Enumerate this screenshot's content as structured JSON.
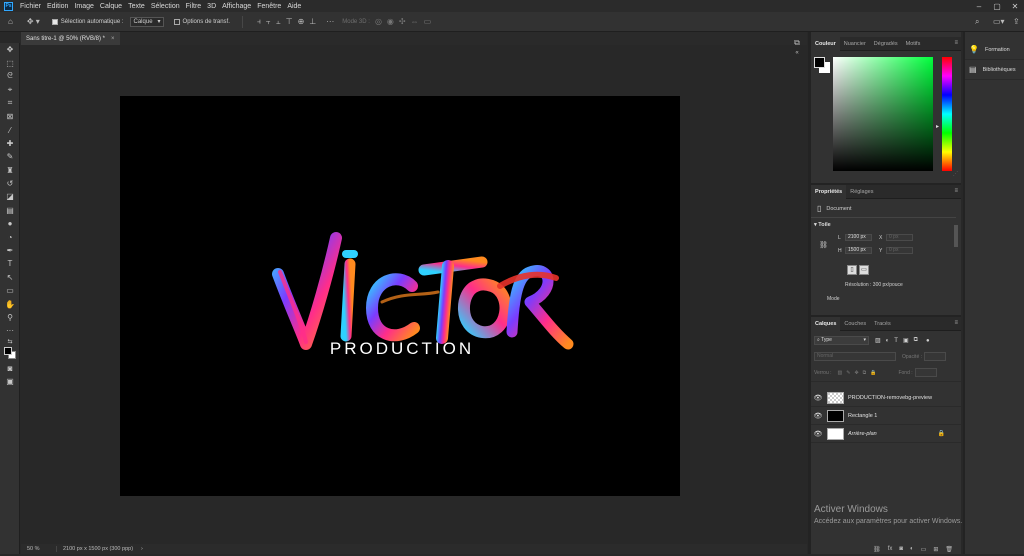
{
  "menubar": {
    "app_icon": "Ps",
    "items": [
      "Fichier",
      "Edition",
      "Image",
      "Calque",
      "Texte",
      "Sélection",
      "Filtre",
      "3D",
      "Affichage",
      "Fenêtre",
      "Aide"
    ]
  },
  "options_bar": {
    "auto_select_label": "Sélection automatique :",
    "auto_select_value": "Calque",
    "transform_label": "Options de transf.",
    "mode_3d_label": "Mode 3D :"
  },
  "document": {
    "tab_label": "Sans titre-1 @ 50% (RVB/8) *",
    "close_glyph": "×"
  },
  "artwork": {
    "title_text": "Victor",
    "subtitle_text": "PRODUCTION",
    "colors": {
      "cyan": "#2fd1ff",
      "magenta": "#ff2d8a",
      "orange": "#ff8a1f",
      "purple": "#7b3cff",
      "red": "#e8322a"
    }
  },
  "status": {
    "zoom": "50 %",
    "doc_size": "2100 px x 1500 px (300 ppp)",
    "arrow": "›"
  },
  "color_panel": {
    "tabs": [
      "Couleur",
      "Nuancier",
      "Dégradés",
      "Motifs"
    ],
    "active_tab": "Couleur",
    "hue": "#00ff3c"
  },
  "properties_panel": {
    "tabs": [
      "Propriétés",
      "Réglages"
    ],
    "active_tab": "Propriétés",
    "doc_label": "Document",
    "section_label": "Toile",
    "w_label": "L",
    "w_value": "2100 px",
    "h_label": "H",
    "h_value": "1500 px",
    "x_label": "X",
    "y_label": "Y",
    "x_placeholder": "0 px",
    "y_placeholder": "0 px",
    "resolution": "Résolution : 300 px/pouce",
    "mode_label": "Mode"
  },
  "layers_panel": {
    "tabs": [
      "Calques",
      "Couches",
      "Tracés"
    ],
    "active_tab": "Calques",
    "filter_label": "Type",
    "blend_mode": "Normal",
    "opacity_label": "Opacité :",
    "lock_label": "Verrou :",
    "fill_label": "Fond :",
    "layers": [
      {
        "name": "PRODUCTION-removebg-preview",
        "visible": true,
        "italic": false
      },
      {
        "name": "Rectangle 1",
        "visible": true,
        "italic": false
      },
      {
        "name": "Arrière-plan",
        "visible": true,
        "italic": true
      }
    ]
  },
  "right_panel": {
    "items": [
      {
        "label": "Formation",
        "icon": "lightbulb-icon"
      },
      {
        "label": "Bibliothèques",
        "icon": "library-icon"
      }
    ]
  },
  "windows_watermark": {
    "title": "Activer Windows",
    "subtitle": "Accédez aux paramètres pour activer Windows."
  }
}
